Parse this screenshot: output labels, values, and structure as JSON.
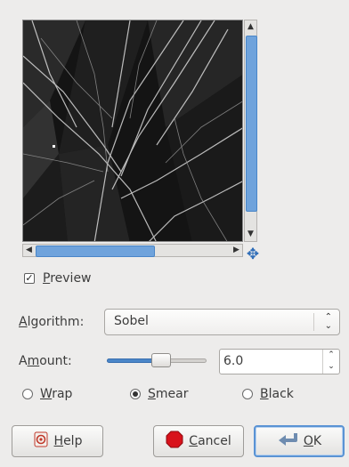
{
  "preview": {
    "checkbox_label": "Preview",
    "checked": true
  },
  "algorithm": {
    "label": "Algorithm:",
    "selected": "Sobel"
  },
  "amount": {
    "label": "Amount:",
    "value": "6.0",
    "slider_fraction": 0.55
  },
  "edge_behavior": {
    "options": [
      {
        "label": "Wrap",
        "selected": false
      },
      {
        "label": "Smear",
        "selected": true
      },
      {
        "label": "Black",
        "selected": false
      }
    ]
  },
  "buttons": {
    "help": "Help",
    "cancel": "Cancel",
    "ok": "OK"
  },
  "icons": {
    "help": "help-icon",
    "cancel": "stop-icon",
    "ok": "ok-arrow-icon",
    "navigate": "move-arrows-icon"
  },
  "colors": {
    "accent": "#4a86c8",
    "cancel_red": "#d8121b"
  }
}
